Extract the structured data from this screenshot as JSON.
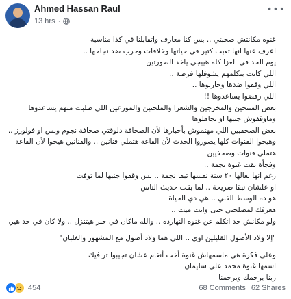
{
  "post": {
    "author": "Ahmed Hassan Raul",
    "time": "13 hrs",
    "privacy_separator": "·",
    "privacy_icon": "globe-icon",
    "more_icon": "more-options-icon",
    "lines": [
      "غنوة مكانتش صحبتي .. بس كنا معارف واتقابلنا في كذا مناسبة",
      "اعرف عنها انها تعبت كتير في حياتها وخلافات وحرب ضد نجاحها ..",
      "يوم الحد في العزا كله هييجي ياخد الصورتين",
      "اللي كانت بتكلمهم يشوفلها فرصة ..",
      "اللي وقفوا ضدها وحاربوها ..",
      "اللي رفضوا يساعدوها !!",
      "بعض المنتجين والمخرجين والشعرا والملحنين والموزعين اللي طلبت منهم يساعدوها وماوقفوش جنبها او تجاهلوها",
      "بعض الصحفيين اللي مهتموش بأخبارها لأن الصحافة دلوقتي صحافة نجوم وبس او فولورز ..",
      "وهيجوا القنوات كلها يصوروا الحدث لأن الفاعة هتملي فنانين .. والفنانين هيجوا لأن القاعة هتملي قنوات وصحفيين",
      "وفجأة بقت غنوة نجمة ..",
      "رغم انها بغالها ٢٠ سنة نفسها تبقا نجمة .. بس وقفوا جنبها لما توفت",
      "او علشان نبقا صريحة .. لما بقت حديث الناس",
      "هو ده الوسط الفني .. هي دي الحياة",
      "هعرفك لمصلحتي حتى وانت ميت ..",
      "ولو مكانش حد اتكلم عن غنوة النهاردة .. والله ماكان في خبر هيتنزل .. ولا كان في حد هيروح العزا ولا الدفنة",
      "\"إلا ولاد الأصول القليلين اوي .. اللي هما ولاد أصول مع المشهور والغلبان\"",
      "وعلى فكرة هي ماسمهاش غنوة أخت أنغام عشان تجيبوا ترافيك",
      "اسمها غنوة محمد علي سليمان",
      "ربنا يرحمك ويرحمنا"
    ],
    "reactions": {
      "icons": [
        "like-icon",
        "sad-icon"
      ],
      "colors": {
        "like": "#1877f2",
        "sad": "#f7c94b"
      },
      "count": "454"
    },
    "comments": "68 Comments",
    "shares": "62 Shares"
  }
}
